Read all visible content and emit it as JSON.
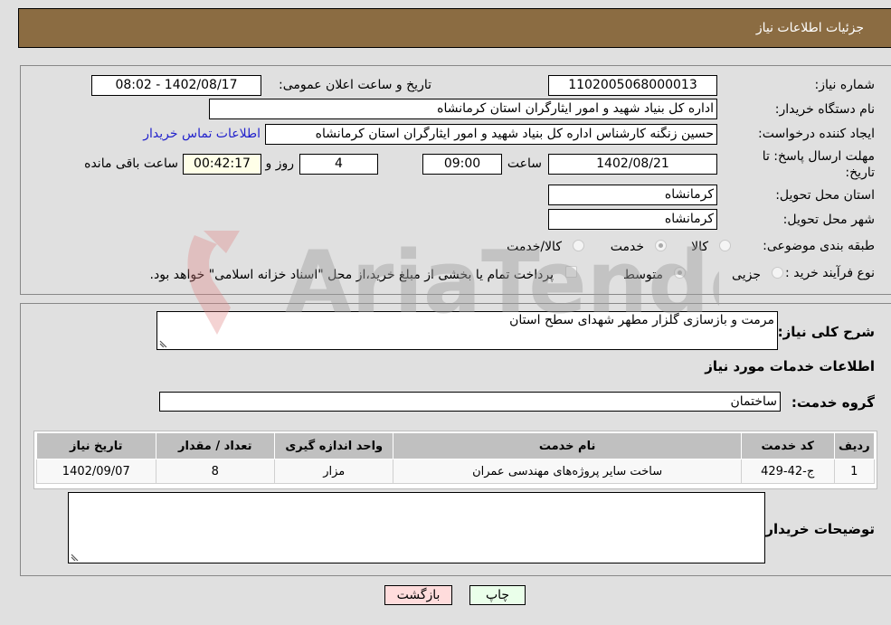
{
  "header": {
    "title": "جزئیات اطلاعات نیاز"
  },
  "form": {
    "need_number": {
      "label": "شماره نیاز:",
      "value": "1102005068000013"
    },
    "announce_datetime": {
      "label": "تاریخ و ساعت اعلان عمومی:",
      "value": "1402/08/17 - 08:02"
    },
    "buyer_org": {
      "label": "نام دستگاه خریدار:",
      "value": "اداره کل بنیاد شهید و امور ایثارگران استان کرمانشاه"
    },
    "creator": {
      "label": "ایجاد کننده درخواست:",
      "value": "حسین زنگنه کارشناس اداره کل بنیاد شهید و امور ایثارگران استان کرمانشاه",
      "contact_link": "اطلاعات تماس خریدار"
    },
    "deadline": {
      "label_line1": "مهلت ارسال پاسخ: تا",
      "label_line2": "تاریخ:",
      "date": "1402/08/21",
      "time_label": "ساعت",
      "time": "09:00",
      "days": "4",
      "days_label": "روز و",
      "remaining": "00:42:17",
      "remaining_label": "ساعت باقی مانده"
    },
    "province": {
      "label": "استان محل تحویل:",
      "value": "کرمانشاه"
    },
    "city": {
      "label": "شهر محل تحویل:",
      "value": "کرمانشاه"
    },
    "category": {
      "label": "طبقه بندی موضوعی:",
      "options": [
        "کالا",
        "خدمت",
        "کالا/خدمت"
      ],
      "selected": "خدمت"
    },
    "purchase_type": {
      "label": "نوع فرآیند خرید :",
      "options": [
        "جزیی",
        "متوسط"
      ],
      "selected": "متوسط",
      "treasury_note": "پرداخت تمام یا بخشی از مبلغ خرید،از محل \"اسناد خزانه اسلامی\" خواهد بود."
    }
  },
  "details": {
    "description_label": "شرح کلی نیاز:",
    "description": "مرمت و بازسازی گلزار مطهر شهدای سطح استان",
    "services_heading": "اطلاعات خدمات مورد نیاز",
    "service_group_label": "گروه خدمت:",
    "service_group": "ساختمان",
    "table": {
      "headers": [
        "ردیف",
        "کد خدمت",
        "نام خدمت",
        "واحد اندازه گیری",
        "تعداد / مقدار",
        "تاریخ نیاز"
      ],
      "rows": [
        [
          "1",
          "ج-42-429",
          "ساخت سایر پروژه‌های مهندسی عمران",
          "مزار",
          "8",
          "1402/09/07"
        ]
      ]
    },
    "buyer_notes_label": "توضیحات خریدار:",
    "buyer_notes": ""
  },
  "buttons": {
    "print": "چاپ",
    "back": "بازگشت"
  },
  "watermark": {
    "text": "AriaTender.net"
  },
  "colors": {
    "header_bg": "#8b6c42",
    "print_btn_bg": "#eaffea",
    "back_btn_bg": "#ffdcdc",
    "link": "#2222cc"
  }
}
